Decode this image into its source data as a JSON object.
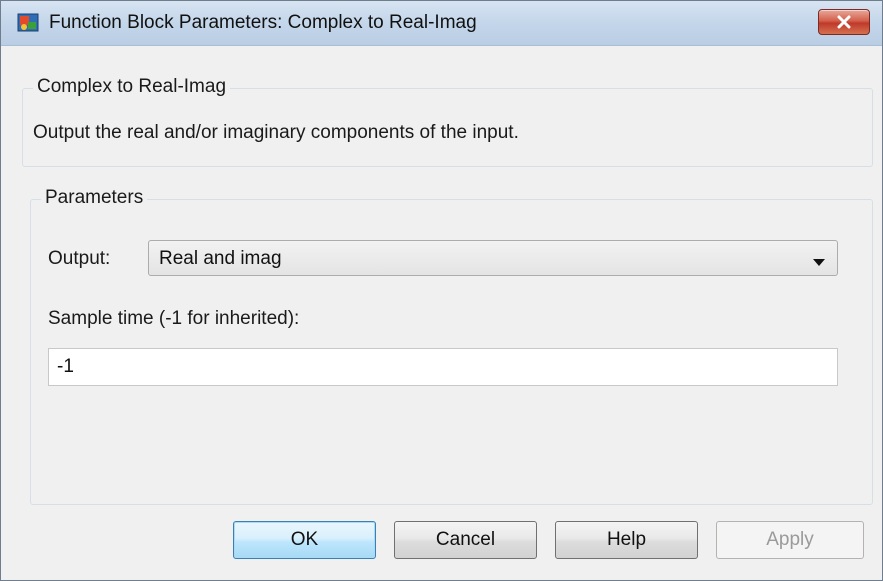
{
  "window": {
    "title": "Function Block Parameters: Complex to Real-Imag",
    "close_label": "close"
  },
  "description": {
    "group_title": "Complex to Real-Imag",
    "text": "Output the real and/or imaginary components of the input."
  },
  "parameters": {
    "group_title": "Parameters",
    "output_label": "Output:",
    "output_value": "Real and imag",
    "sample_time_label": "Sample time (-1 for inherited):",
    "sample_time_value": "-1"
  },
  "buttons": {
    "ok": "OK",
    "cancel": "Cancel",
    "help": "Help",
    "apply": "Apply"
  },
  "colors": {
    "title_bar": "#c4d6ea",
    "close_button": "#c0392b",
    "ok_button_border": "#3c7fb1",
    "dialog_background": "#f0f0f0"
  },
  "icons": {
    "app": "simulink-block-icon",
    "close": "close-icon",
    "dropdown": "chevron-down-icon"
  }
}
